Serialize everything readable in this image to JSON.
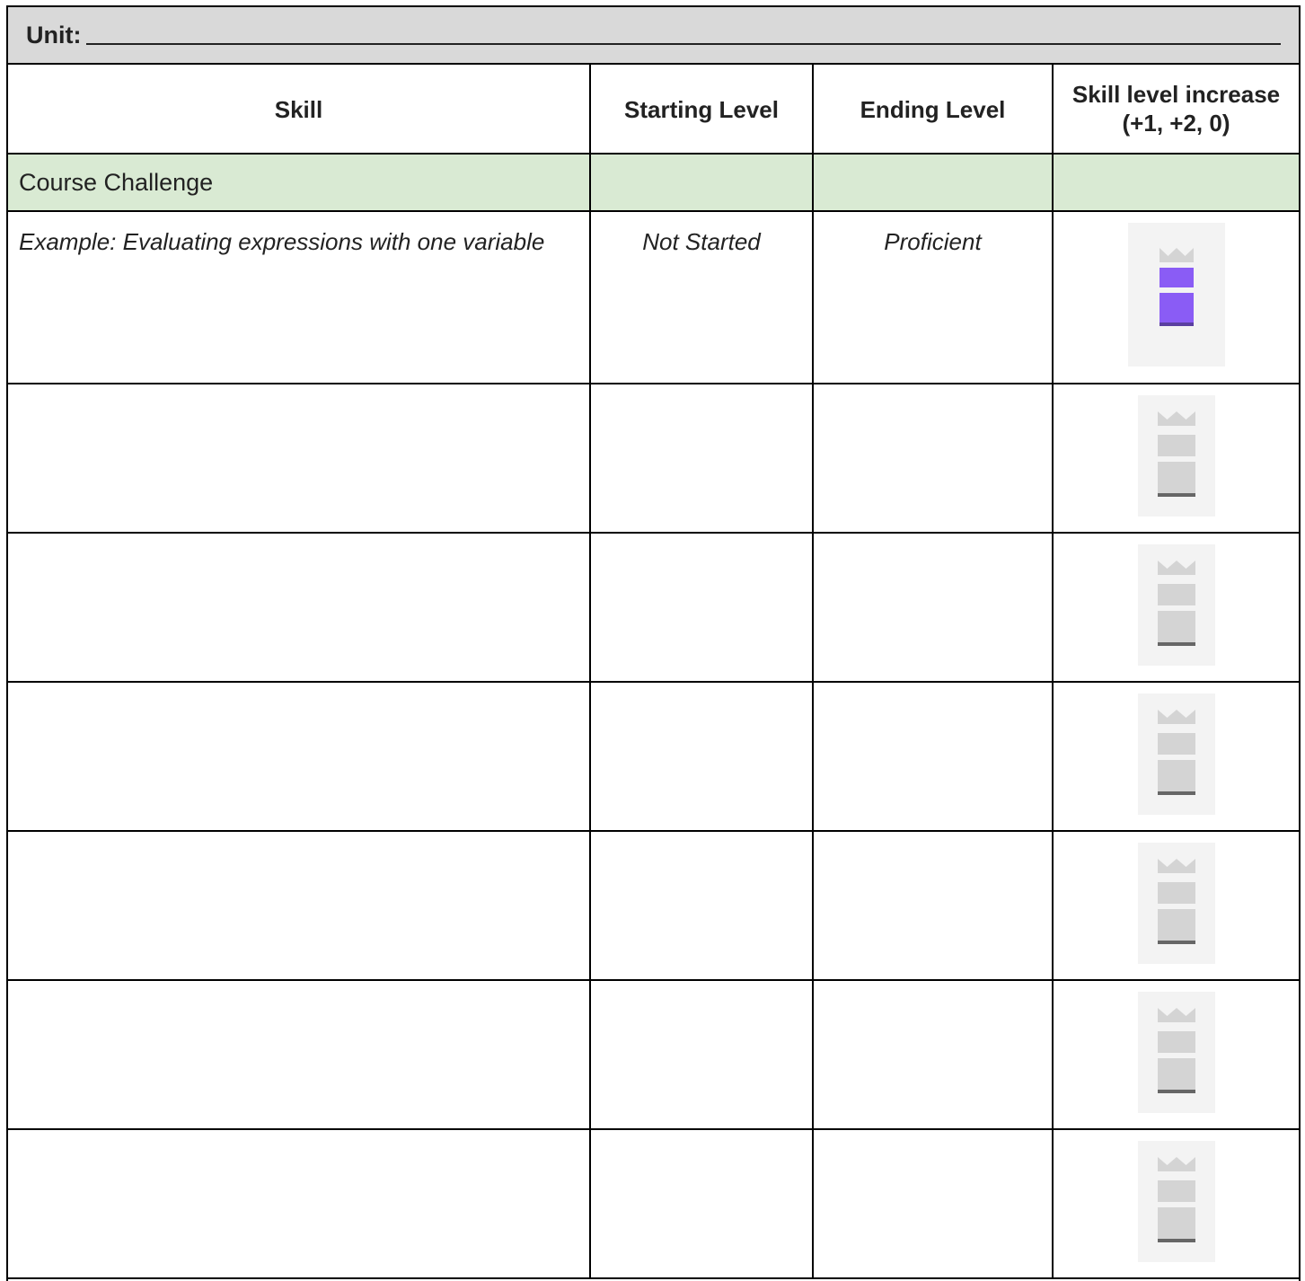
{
  "unit": {
    "label": "Unit:"
  },
  "table": {
    "headers": {
      "skill": "Skill",
      "starting": "Starting Level",
      "ending": "Ending Level",
      "increase_line1": "Skill level increase",
      "increase_line2": "(+1, +2, 0)"
    },
    "challenge_label": "Course Challenge",
    "example": {
      "skill": "Example: Evaluating expressions with one variable",
      "starting": "Not Started",
      "ending": "Proficient",
      "mastery_icon": "mastery-meter-icon",
      "fill_levels": 2
    },
    "blank_rows": [
      {
        "mastery_icon": "mastery-meter-icon",
        "fill_levels": 0
      },
      {
        "mastery_icon": "mastery-meter-icon",
        "fill_levels": 0
      },
      {
        "mastery_icon": "mastery-meter-icon",
        "fill_levels": 0
      },
      {
        "mastery_icon": "mastery-meter-icon",
        "fill_levels": 0
      },
      {
        "mastery_icon": "mastery-meter-icon",
        "fill_levels": 0
      },
      {
        "mastery_icon": "mastery-meter-icon",
        "fill_levels": 0
      }
    ]
  },
  "colors": {
    "header_bg": "#d9d9d9",
    "challenge_bg": "#d9ead3",
    "mastery_active": "#8a5cf5",
    "mastery_inactive": "#d4d4d4",
    "mastery_active_base": "#5a3fa0",
    "mastery_inactive_base": "#666666"
  }
}
